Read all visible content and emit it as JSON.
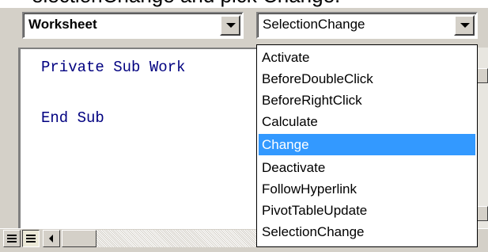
{
  "top_caption": "electionChange and pick Change.",
  "object_combo": {
    "value": "Worksheet"
  },
  "procedure_combo": {
    "value": "SelectionChange"
  },
  "code": {
    "line1": "Private Sub Work",
    "line2": "End Sub"
  },
  "dropdown": {
    "items": [
      "Activate",
      "BeforeDoubleClick",
      "BeforeRightClick",
      "Calculate",
      "Change",
      "Deactivate",
      "FollowHyperlink",
      "PivotTableUpdate",
      "SelectionChange"
    ],
    "highlighted_item": "Change"
  },
  "colors": {
    "highlight": "#3399ff",
    "keyword": "#000080",
    "chrome": "#d4d0c8"
  }
}
